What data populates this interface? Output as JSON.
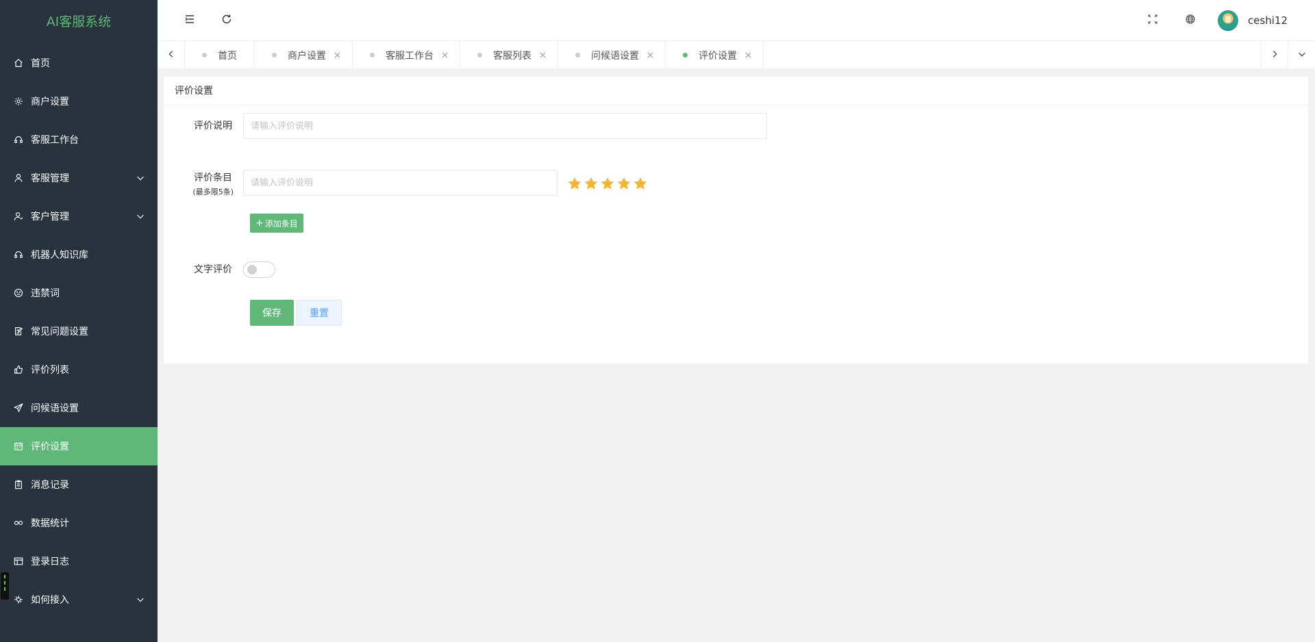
{
  "app": {
    "logo": "AI客服系统"
  },
  "sidebar": {
    "items": [
      {
        "label": "首页",
        "icon": "home-icon"
      },
      {
        "label": "商户设置",
        "icon": "gear-icon"
      },
      {
        "label": "客服工作台",
        "icon": "headset-icon"
      },
      {
        "label": "客服管理",
        "icon": "user-icon",
        "has_children": true
      },
      {
        "label": "客户管理",
        "icon": "customer-icon",
        "has_children": true
      },
      {
        "label": "机器人知识库",
        "icon": "robot-icon"
      },
      {
        "label": "违禁词",
        "icon": "face-icon"
      },
      {
        "label": "常见问题设置",
        "icon": "edit-doc-icon"
      },
      {
        "label": "评价列表",
        "icon": "thumb-up-icon"
      },
      {
        "label": "问候语设置",
        "icon": "send-icon"
      },
      {
        "label": "评价设置",
        "icon": "calendar-icon",
        "active": true
      },
      {
        "label": "消息记录",
        "icon": "clipboard-icon"
      },
      {
        "label": "数据统计",
        "icon": "link-icon"
      },
      {
        "label": "登录日志",
        "icon": "table-icon"
      },
      {
        "label": "如何接入",
        "icon": "plug-icon",
        "has_children": true
      }
    ]
  },
  "header": {
    "user": {
      "name": "ceshi12"
    }
  },
  "tabs": [
    {
      "label": "首页",
      "closable": false
    },
    {
      "label": "商户设置",
      "closable": true
    },
    {
      "label": "客服工作台",
      "closable": true
    },
    {
      "label": "客服列表",
      "closable": true
    },
    {
      "label": "问候语设置",
      "closable": true
    },
    {
      "label": "评价设置",
      "closable": true,
      "active": true
    }
  ],
  "card": {
    "title": "评价设置",
    "description": {
      "label": "评价说明",
      "placeholder": "请输入评价说明",
      "value": ""
    },
    "items": {
      "label": "评价条目",
      "sublabel": "(最多限5条)",
      "placeholder": "请输入评价说明",
      "value": "",
      "rating": 5,
      "max_rating": 5,
      "star_color": "#f5b530"
    },
    "add_button": "添加条目",
    "text_review": {
      "label": "文字评价",
      "enabled": false
    },
    "save_button": "保存",
    "reset_button": "重置"
  },
  "colors": {
    "accent": "#5fb878",
    "sidebar_bg": "#28333e"
  }
}
